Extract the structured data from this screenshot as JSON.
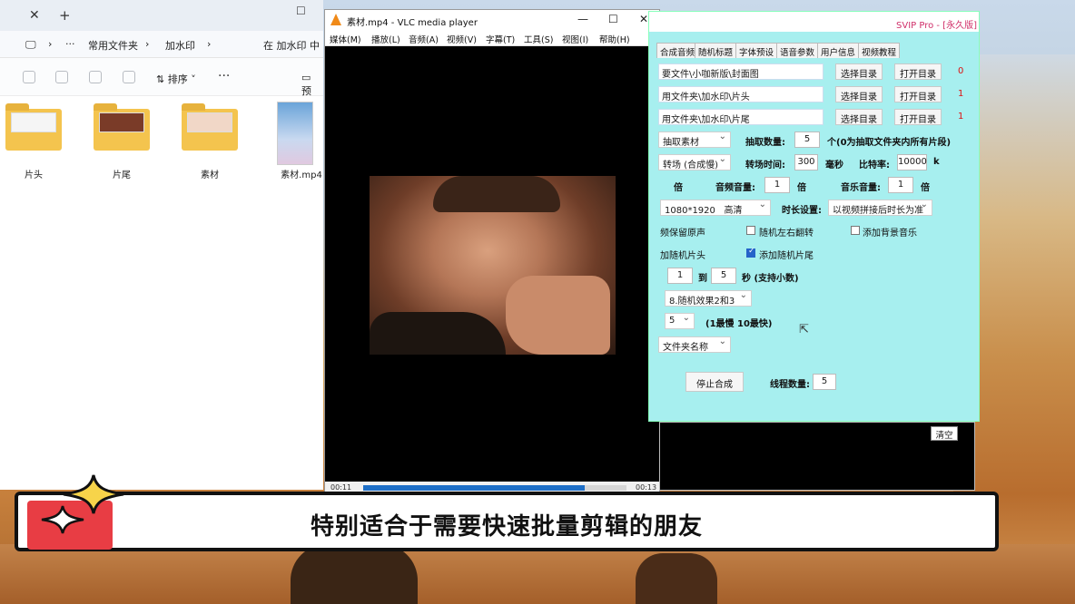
{
  "explorer": {
    "tab_close": "✕",
    "tab_new": "+",
    "win_button": "☐",
    "addr_more": "···",
    "addr_path1": "常用文件夹",
    "addr_path2": "加水印",
    "search_placeholder": "在 加水印 中",
    "sort_label": "排序",
    "more": "···",
    "preview_label": "预",
    "files": [
      {
        "name": "片头",
        "kind": "folder"
      },
      {
        "name": "片尾",
        "kind": "folder"
      },
      {
        "name": "素材",
        "kind": "folder"
      },
      {
        "name": "素材.mp4",
        "kind": "video"
      }
    ]
  },
  "vlc": {
    "title": "素材.mp4 - VLC media player",
    "minimize": "—",
    "maximize": "☐",
    "close": "✕",
    "menus": [
      "媒体(M)",
      "播放(L)",
      "音频(A)",
      "视频(V)",
      "字幕(T)",
      "工具(S)",
      "视图(I)",
      "帮助(H)"
    ],
    "time_elapsed": "00:11",
    "time_total": "00:13",
    "progress": 0.84
  },
  "svip": {
    "title": "SVIP Pro - [永久版]",
    "tabs": [
      "合成音频",
      "随机标题",
      "字体预设",
      "语音参数",
      "用户信息",
      "视频教程"
    ],
    "paths": [
      {
        "value": "要文件\\小咖新版\\封面图",
        "btn1": "选择目录",
        "btn2": "打开目录",
        "count": "0"
      },
      {
        "value": "用文件夹\\加水印\\片头",
        "btn1": "选择目录",
        "btn2": "打开目录",
        "count": "1"
      },
      {
        "value": "用文件夹\\加水印\\片尾",
        "btn1": "选择目录",
        "btn2": "打开目录",
        "count": "1"
      }
    ],
    "extract_mode": "抽取素材",
    "extract_count_label": "抽取数量:",
    "extract_count": "5",
    "extract_note": "个(0为抽取文件夹内所有片段)",
    "transition": "转场 (合成慢)",
    "transition_time_label": "转场时间:",
    "transition_time": "300",
    "ms_unit": "毫秒",
    "bitrate_label": "比特率:",
    "bitrate": "10000",
    "bitrate_unit": "k",
    "speed_unit": "倍",
    "audio_vol_label": "音频音量:",
    "audio_vol": "1",
    "music_vol_label": "音乐音量:",
    "music_vol": "1",
    "resolution": "1080*1920",
    "quality": "高清",
    "duration_label": "时长设置:",
    "duration": "以视频拼接后时长为准",
    "keep_audio": "频保留原声",
    "random_flip": "随机左右翻转",
    "add_music": "添加背景音乐",
    "random_head": "加随机片头",
    "random_tail": "添加随机片尾",
    "range_from": "1",
    "range_to_label": "到",
    "range_to": "5",
    "range_unit": "秒 (支持小数)",
    "effect": "8.随机效果2和3",
    "speed": "5",
    "speed_note": "(1最慢 10最快)",
    "naming": "文件夹名称",
    "stop_btn": "停止合成",
    "threads_label": "线程数量:",
    "threads": "5",
    "clear_btn": "清空"
  },
  "caption": "特别适合于需要快速批量剪辑的朋友"
}
